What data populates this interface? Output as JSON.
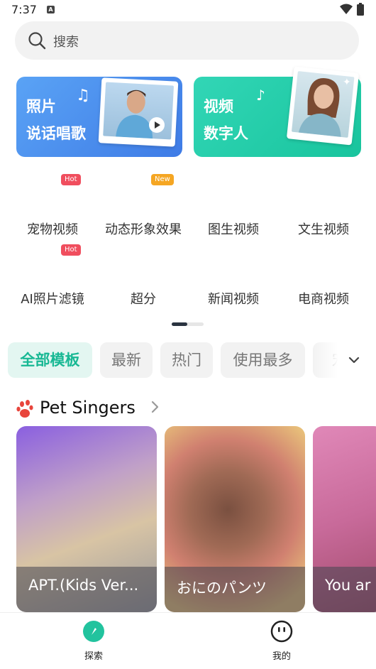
{
  "status_bar": {
    "time": "7:37",
    "notification_icon": "a-icon"
  },
  "search": {
    "placeholder": "搜索"
  },
  "promos": [
    {
      "line1": "照片",
      "line2": "说话唱歌",
      "color": "#4a8ff0"
    },
    {
      "line1": "视频",
      "line2": "数字人",
      "color": "#22cca8"
    }
  ],
  "tools_row1": {
    "badges": [
      "Hot",
      "New"
    ],
    "labels": [
      "宠物视频",
      "动态形象效果",
      "图生视频",
      "文生视频"
    ]
  },
  "tools_row2": {
    "badges": [
      "Hot"
    ],
    "labels": [
      "AI照片滤镜",
      "超分",
      "新闻视频",
      "电商视频"
    ]
  },
  "filters": {
    "chips": [
      "全部模板",
      "最新",
      "热门",
      "使用最多",
      "宠"
    ],
    "active_index": 0,
    "accent": "#18b894"
  },
  "section": {
    "title": "Pet Singers"
  },
  "templates": [
    {
      "title": "APT.(Kids Ver..."
    },
    {
      "title": "おにのパンツ"
    },
    {
      "title": "You ar"
    }
  ],
  "bottom_nav": [
    {
      "label": "探索",
      "icon": "explore-icon",
      "active": true
    },
    {
      "label": "我的",
      "icon": "profile-face-icon",
      "active": false
    }
  ]
}
